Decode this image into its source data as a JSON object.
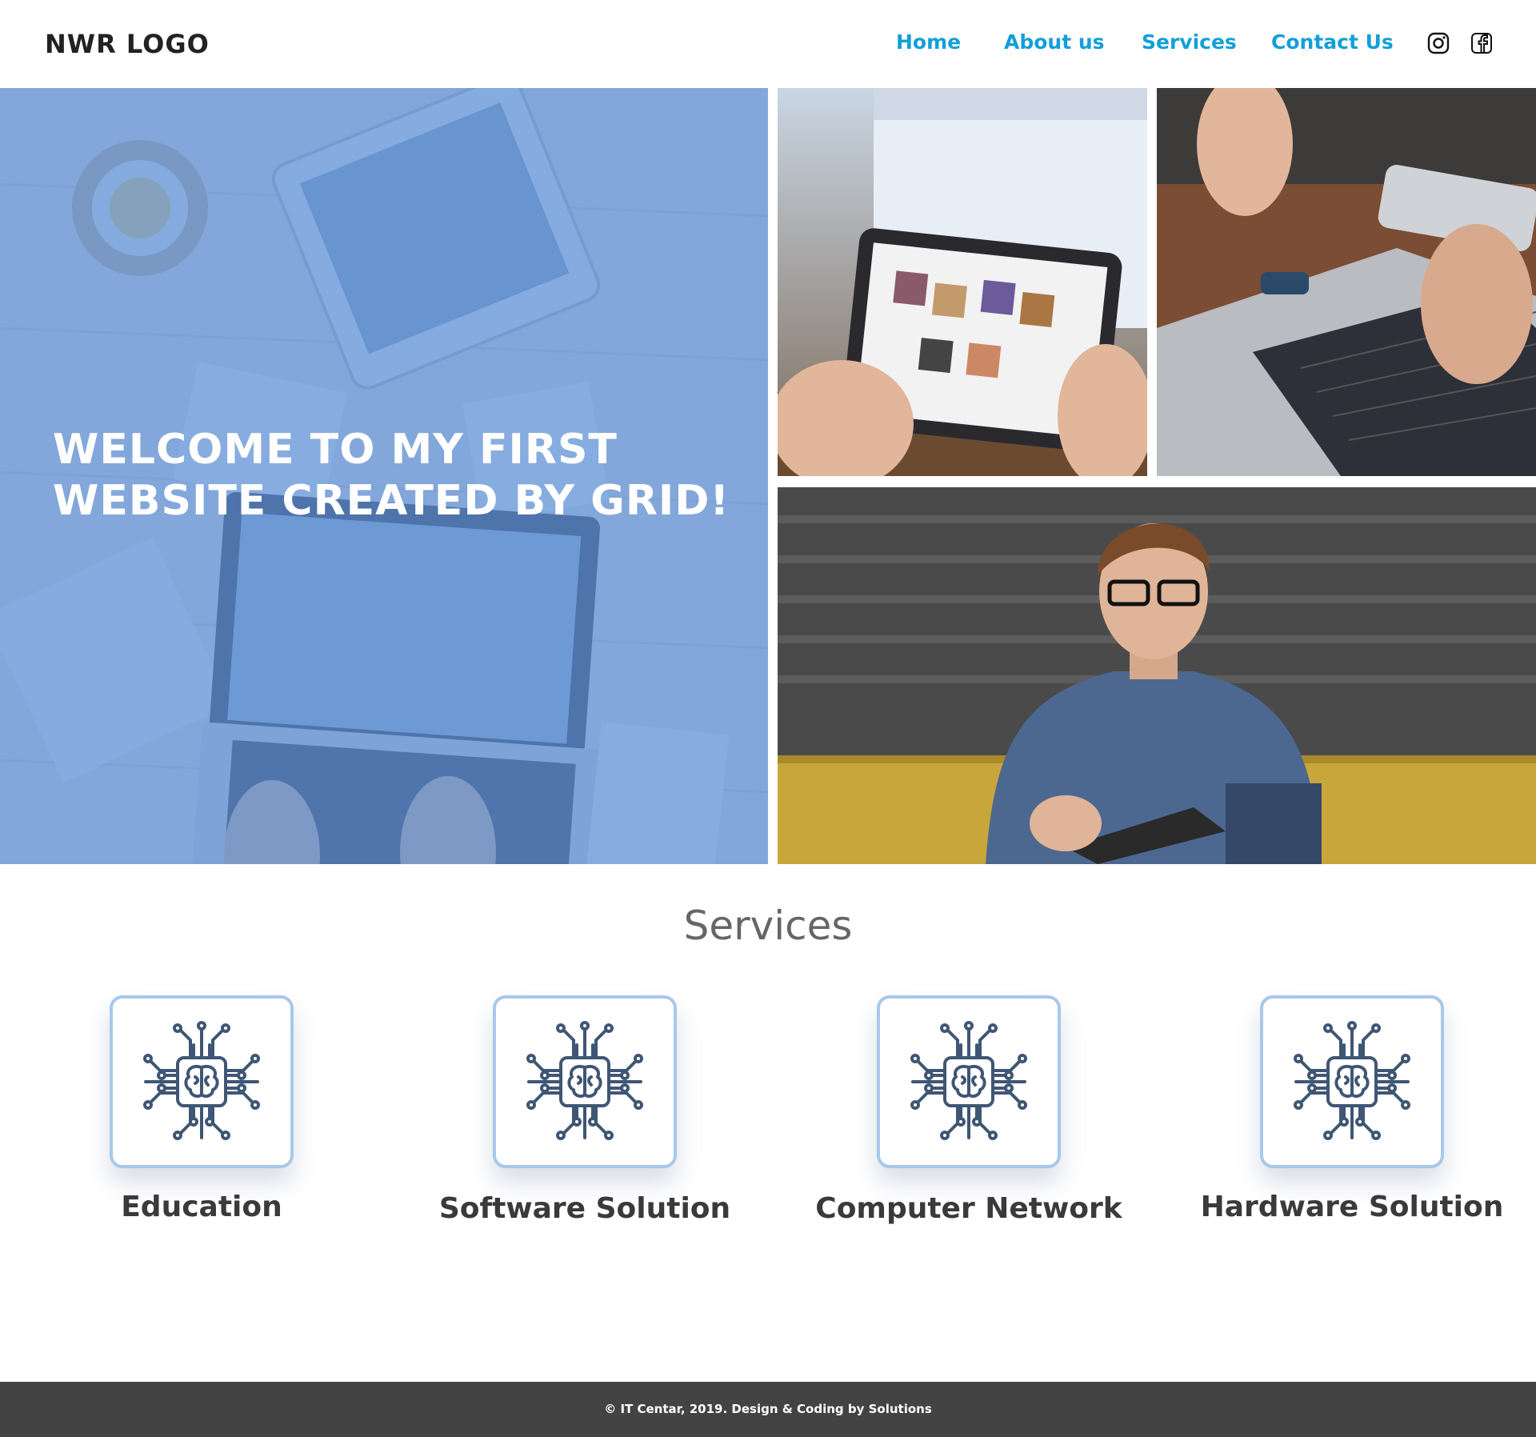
{
  "header": {
    "logo": "NWR LOGO",
    "nav": [
      "Home",
      "About us",
      "Services",
      "Contact Us"
    ],
    "social_icons": [
      "instagram-icon",
      "facebook-icon"
    ]
  },
  "hero": {
    "title": "WELCOME TO MY FIRST WEBSITE CREATED BY GRID!",
    "overlay_color": "#5b8fd8"
  },
  "services": {
    "heading": "Services",
    "icon": "ai-chip-brain-icon",
    "items": [
      "Education",
      "Software Solution",
      "Computer Network",
      "Hardware Solution"
    ]
  },
  "footer": {
    "text": "© IT Centar, 2019. Design & Coding by Solutions"
  },
  "colors": {
    "nav": "#139fd8",
    "card_border": "#a9c8ea",
    "footer_bg": "#434343"
  }
}
